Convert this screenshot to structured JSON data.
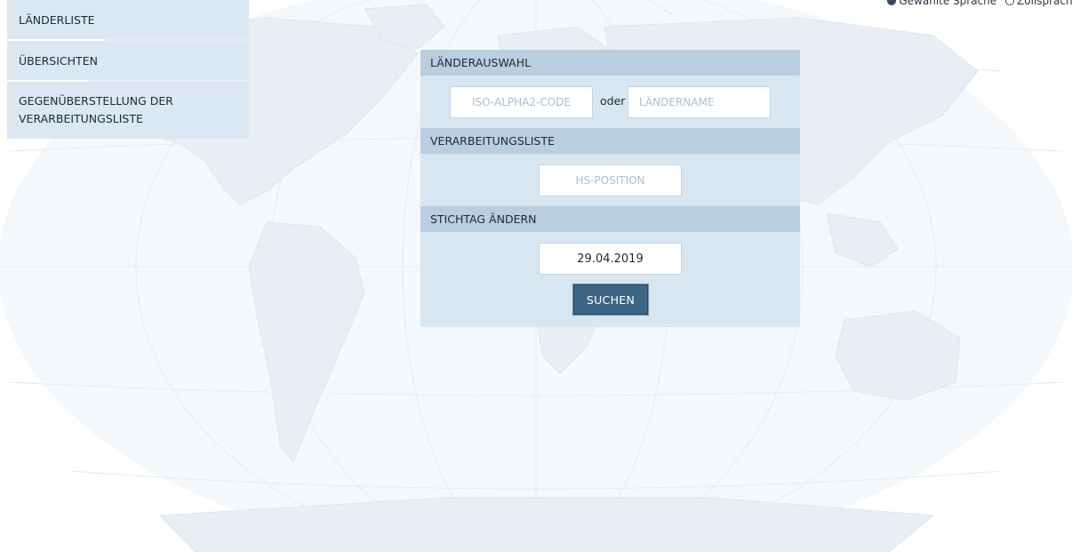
{
  "language_bar": {
    "items": [
      {
        "label": "Gewählte Sprache",
        "icon": "globe-icon"
      },
      {
        "label": "Zollsprache",
        "icon": "flag-icon"
      }
    ]
  },
  "side_nav": {
    "items": [
      {
        "label": "LÄNDERLISTE"
      },
      {
        "label": "ÜBERSICHTEN"
      },
      {
        "label": "GEGENÜBERSTELLUNG DER VERARBEITUNGSLISTE"
      }
    ]
  },
  "search_panel": {
    "country_section": {
      "title": "LÄNDERAUSWAHL",
      "iso_placeholder": "ISO-ALPHA2-CODE",
      "or_label": "oder",
      "name_placeholder": "LÄNDERNAME"
    },
    "processing_section": {
      "title": "VERARBEITUNGSLISTE",
      "hs_placeholder": "HS-POSITION"
    },
    "date_section": {
      "title": "STICHTAG ÄNDERN",
      "date_value": "29.04.2019"
    },
    "search_button_label": "SUCHEN"
  },
  "colors": {
    "nav_background": "#dbe7f2",
    "panel_background": "#d8e6f2",
    "section_header": "#b9cfe1",
    "button": "#3d6584",
    "map_land": "#e9eff4",
    "map_ocean": "#f6f9fb"
  }
}
